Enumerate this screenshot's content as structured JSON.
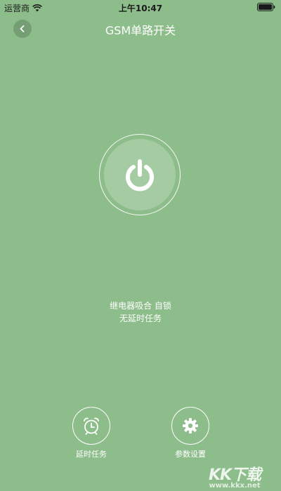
{
  "status_bar": {
    "carrier": "运营商",
    "time": "上午10:47",
    "icons": [
      "wifi-icon",
      "battery-icon"
    ]
  },
  "header": {
    "title": "GSM单路开关",
    "back_icon": "chevron-left-icon"
  },
  "power": {
    "icon": "power-icon"
  },
  "status": {
    "line1": "继电器吸合 自锁",
    "line2": "无延时任务"
  },
  "actions": {
    "delay_task": {
      "label": "延时任务",
      "icon": "alarm-clock-icon"
    },
    "settings": {
      "label": "参数设置",
      "icon": "gear-icon"
    }
  },
  "watermark": {
    "logo": "KK下载",
    "url": "www.kkx.net"
  },
  "colors": {
    "background": "#8cbd8a",
    "foreground": "#ffffff"
  }
}
